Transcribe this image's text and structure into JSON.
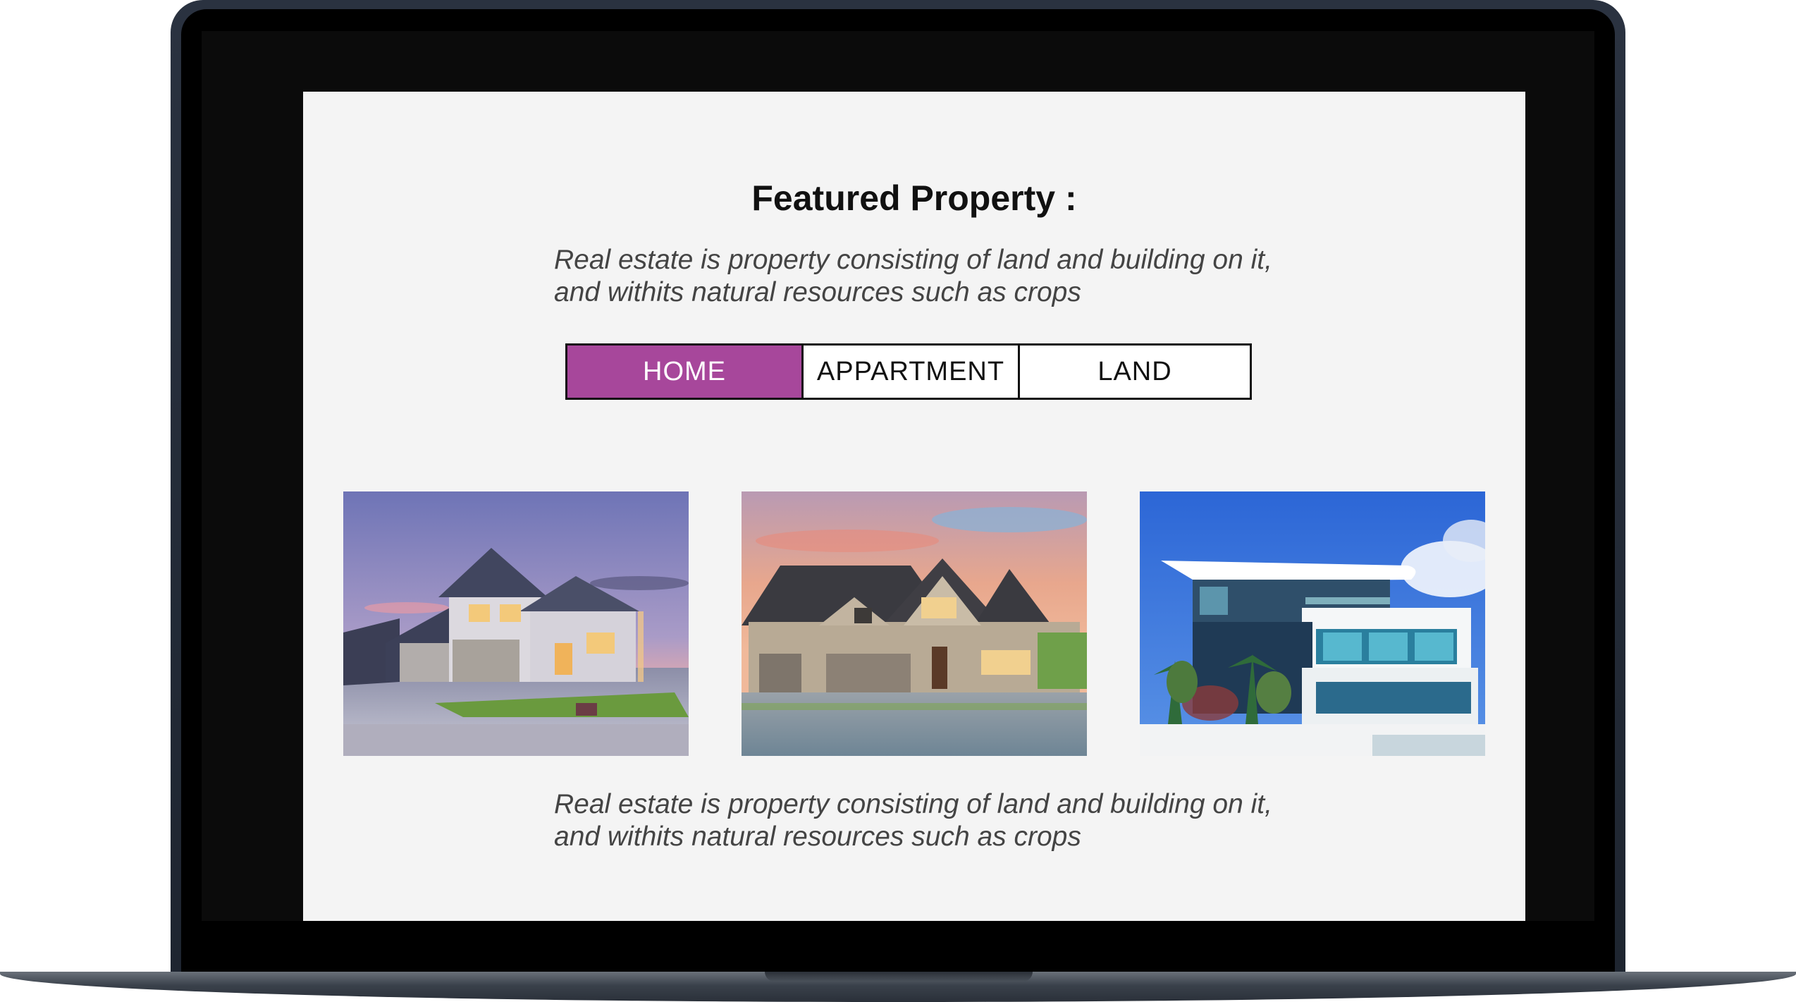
{
  "section": {
    "title": "Featured Property :",
    "description_top": [
      "Real estate is property consisting of land and building on it,",
      "and withits natural resources such as crops"
    ],
    "description_bottom": [
      "Real estate is property consisting of land and building on it,",
      "and withits natural resources such as crops"
    ]
  },
  "tabs": [
    {
      "label": "HOME",
      "active": true
    },
    {
      "label": "APPARTMENT",
      "active": false
    },
    {
      "label": "LAND",
      "active": false
    }
  ],
  "colors": {
    "accent": "#a7479b",
    "page_background": "#f4f4f4",
    "text": "#111111"
  },
  "photos": [
    {
      "icon": "house-dusk-photo"
    },
    {
      "icon": "house-sunset-photo"
    },
    {
      "icon": "modern-house-photo"
    }
  ]
}
